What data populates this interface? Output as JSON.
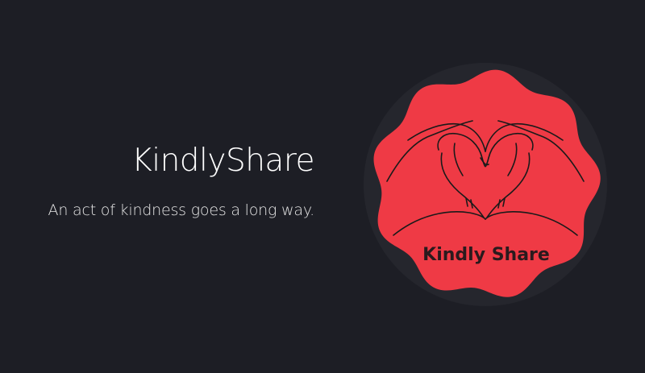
{
  "hero": {
    "title": "KindlyShare",
    "tagline": "An act of kindness goes a long way."
  },
  "logo": {
    "text": "Kindly Share",
    "icon": "heart-hands-icon",
    "badge_color": "#ef3a45",
    "ring_color": "#25262d",
    "line_color": "#1a1a1a"
  }
}
